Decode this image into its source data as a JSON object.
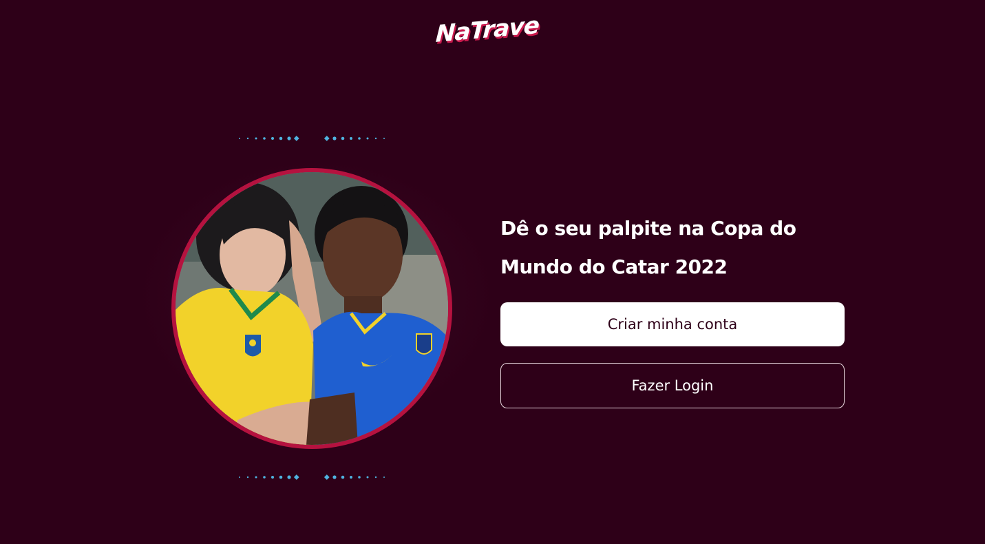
{
  "brand": {
    "logo_text": "NaTrave",
    "logo_color": "#ffffff",
    "logo_shadow_color": "#c8194c"
  },
  "hero": {
    "image_icon": "photo-fans-brazil-jerseys",
    "ring_color": "#b5123f",
    "accent_dot_color": "#4fb3e0"
  },
  "content": {
    "headline": "Dê o seu palpite na Copa do Mundo do Catar 2022",
    "primary_button_label": "Criar minha conta",
    "secondary_button_label": "Fazer Login"
  },
  "theme": {
    "background": "#2e0018",
    "primary_button_bg": "#ffffff",
    "primary_button_text": "#2e0018",
    "secondary_button_border": "#e8d6de"
  }
}
